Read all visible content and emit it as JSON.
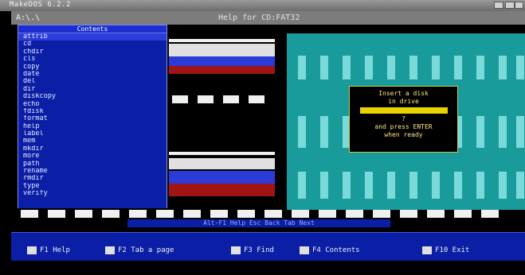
{
  "window": {
    "title": "MakeDOS 6.2.2"
  },
  "topbar": {
    "path": "A:\\.\\",
    "title": "Help for CD:FAT32"
  },
  "sidebar": {
    "header": "Contents",
    "selected_index": 0,
    "items": [
      "attrib",
      "cd",
      "chdir",
      "cls",
      "copy",
      "date",
      "del",
      "dir",
      "diskcopy",
      "echo",
      "fdisk",
      "format",
      "help",
      "label",
      "mem",
      "mkdir",
      "more",
      "path",
      "rename",
      "rmdir",
      "type",
      "verify"
    ]
  },
  "dialog": {
    "lines": [
      "Insert a disk",
      "in drive",
      "?",
      "and press ENTER",
      "when ready"
    ]
  },
  "statusline": {
    "text": "Alt-F1 Help  Esc Back  Tab Next"
  },
  "fkeys": [
    {
      "label": "F1 Help"
    },
    {
      "label": "F2 Tab a page"
    },
    {
      "label": "F3 Find"
    },
    {
      "label": "F4 Contents"
    },
    {
      "label": "F10 Exit"
    }
  ],
  "colors": {
    "sidebar_bg": "#0b1fa6",
    "panel_bg": "#1a9b9b",
    "dialog_text": "#ffe680",
    "highlight": "#e8d200"
  }
}
